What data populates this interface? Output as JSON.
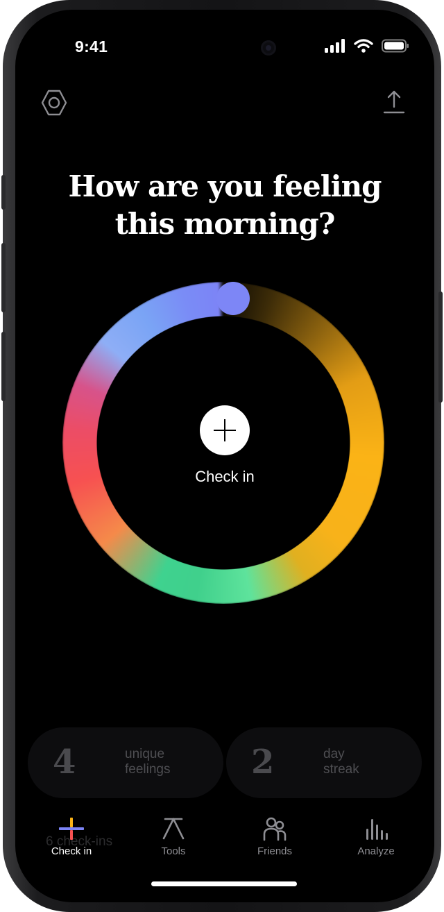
{
  "status_bar": {
    "time": "9:41",
    "icons": [
      "signal-icon",
      "wifi-icon",
      "battery-icon"
    ]
  },
  "header": {
    "left_icon": "hexagon-settings-icon",
    "right_icon": "share-icon"
  },
  "prompt": {
    "line1": "How are you feeling",
    "line2": "this morning?"
  },
  "mood_ring": {
    "colors": {
      "yellow": "#fbb316",
      "green": "#3fd28f",
      "red": "#f75151",
      "blue": "#7c84f6"
    }
  },
  "check_in": {
    "label": "Check in",
    "icon": "plus-icon"
  },
  "stats": [
    {
      "value": "4",
      "label_line1": "unique",
      "label_line2": "feelings"
    },
    {
      "value": "2",
      "label_line1": "day",
      "label_line2": "streak"
    }
  ],
  "ghost_text": "6 check-ins",
  "tab_bar": {
    "tabs": [
      {
        "label": "Check in",
        "icon": "check-in-plus-icon",
        "active": true
      },
      {
        "label": "Tools",
        "icon": "tools-icon",
        "active": false
      },
      {
        "label": "Friends",
        "icon": "friends-icon",
        "active": false
      },
      {
        "label": "Analyze",
        "icon": "bar-chart-icon",
        "active": false
      }
    ]
  }
}
